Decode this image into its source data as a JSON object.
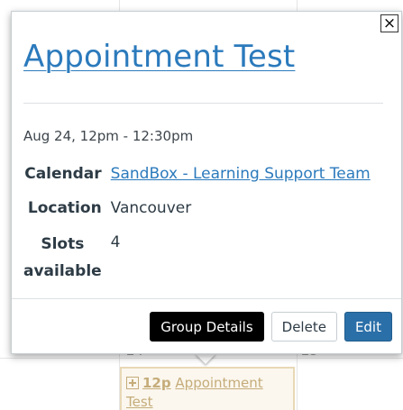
{
  "background": {
    "day_numbers": [
      "24",
      "25"
    ]
  },
  "popover": {
    "close_label": "×",
    "title": "Appointment Test",
    "datetime": "Aug 24, 12pm - 12:30pm",
    "details": {
      "calendar_label": "Calendar",
      "calendar_value": "SandBox - Learning Support Team",
      "location_label": "Location",
      "location_value": "Vancouver",
      "slots_label": "Slots available",
      "slots_value": "4"
    },
    "buttons": {
      "group_details": "Group Details",
      "delete": "Delete",
      "edit": "Edit"
    }
  },
  "event": {
    "time": "12p",
    "title": "Appointment Test",
    "icon": "calendar-event-icon"
  },
  "colors": {
    "link": "#2b7abc",
    "primary": "#2b6fa8",
    "event_text": "#c5ac7a",
    "event_border": "#e8d8b6"
  }
}
